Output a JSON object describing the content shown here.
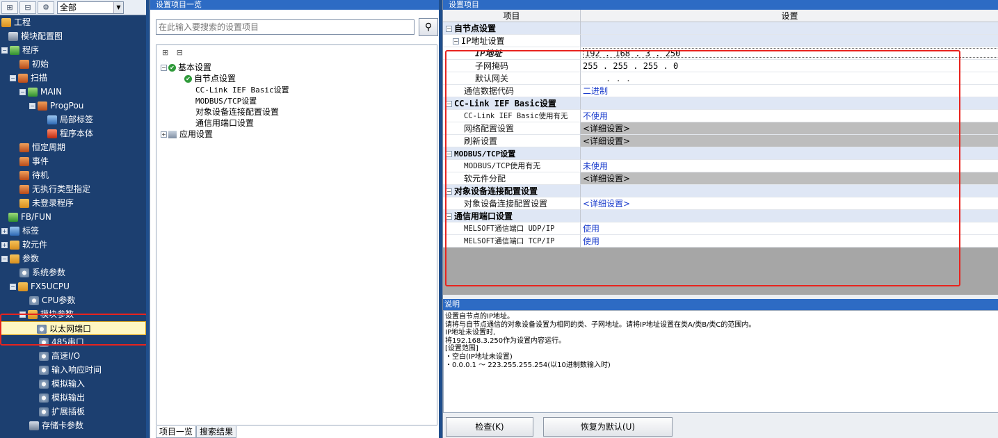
{
  "left": {
    "filter_value": "全部",
    "items": [
      {
        "label": "工程"
      },
      {
        "label": "模块配置图"
      },
      {
        "label": "程序"
      },
      {
        "label": "初始"
      },
      {
        "label": "扫描"
      },
      {
        "label": "MAIN"
      },
      {
        "label": "ProgPou"
      },
      {
        "label": "局部标签"
      },
      {
        "label": "程序本体"
      },
      {
        "label": "恒定周期"
      },
      {
        "label": "事件"
      },
      {
        "label": "待机"
      },
      {
        "label": "无执行类型指定"
      },
      {
        "label": "未登录程序"
      },
      {
        "label": "FB/FUN"
      },
      {
        "label": "标签"
      },
      {
        "label": "软元件"
      },
      {
        "label": "参数"
      },
      {
        "label": "系统参数"
      },
      {
        "label": "FX5UCPU"
      },
      {
        "label": "CPU参数"
      },
      {
        "label": "模块参数"
      },
      {
        "label": "以太网端口"
      },
      {
        "label": "485串口"
      },
      {
        "label": "高速I/O"
      },
      {
        "label": "输入响应时间"
      },
      {
        "label": "模拟输入"
      },
      {
        "label": "模拟输出"
      },
      {
        "label": "扩展插板"
      },
      {
        "label": "存储卡参数"
      }
    ]
  },
  "middle": {
    "title": "设置项目一览",
    "search_placeholder": "在此输入要搜索的设置项目",
    "tree": [
      {
        "label": "基本设置"
      },
      {
        "label": "自节点设置"
      },
      {
        "label": "CC-Link IEF Basic设置"
      },
      {
        "label": "MODBUS/TCP设置"
      },
      {
        "label": "对象设备连接配置设置"
      },
      {
        "label": "通信用端口设置"
      },
      {
        "label": "应用设置"
      }
    ],
    "tabs": [
      "项目一览",
      "搜索结果"
    ]
  },
  "right": {
    "title": "设置项目",
    "header": {
      "item": "项目",
      "setting": "设置"
    },
    "rows": {
      "own_node": {
        "item": "自节点设置"
      },
      "ip_settings": {
        "item": "IP地址设置"
      },
      "ip_address": {
        "item": "IP地址",
        "value": "192 . 168 .   3 . 250"
      },
      "subnet": {
        "item": "子网掩码",
        "value": "255 . 255 . 255 .   0"
      },
      "gateway": {
        "item": "默认网关",
        "value": ".     .     ."
      },
      "comm_code": {
        "item": "通信数据代码",
        "value": "二进制"
      },
      "ccief": {
        "item": "CC-Link IEF Basic设置"
      },
      "ccief_use": {
        "item": "CC-Link IEF Basic使用有无",
        "value": "不使用"
      },
      "network_config": {
        "item": "网络配置设置",
        "value": "<详细设置>"
      },
      "refresh": {
        "item": "刷新设置",
        "value": "<详细设置>"
      },
      "modbus": {
        "item": "MODBUS/TCP设置"
      },
      "modbus_use": {
        "item": "MODBUS/TCP使用有无",
        "value": "未使用"
      },
      "device_alloc": {
        "item": "软元件分配",
        "value": "<详细设置>"
      },
      "target_conn": {
        "item": "对象设备连接配置设置"
      },
      "target_conn_item": {
        "item": "对象设备连接配置设置",
        "value": "<详细设置>"
      },
      "comm_port": {
        "item": "通信用端口设置"
      },
      "udp": {
        "item": "MELSOFT通信端口 UDP/IP",
        "value": "使用"
      },
      "tcp": {
        "item": "MELSOFT通信端口 TCP/IP",
        "value": "使用"
      }
    },
    "description_title": "说明",
    "description": [
      "设置自节点的IP地址。",
      "请将与自节点通信的对象设备设置为相同的类、子网地址。请将IP地址设置在类A/类B/类C的范围内。",
      "IP地址未设置时,",
      "将192.168.3.250作为设置内容运行。",
      "[设置范围]",
      "・空白(IP地址未设置)",
      "・0.0.0.1 ～ 223.255.255.254(以10进制数输入时)"
    ],
    "buttons": {
      "check": "检查(K)",
      "restore": "恢复为默认(U)"
    }
  }
}
